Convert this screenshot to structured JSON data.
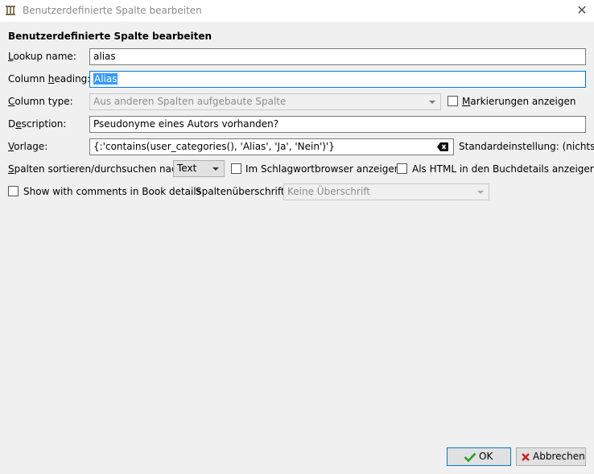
{
  "window": {
    "title": "Benutzerdefinierte Spalte bearbeiten",
    "close_icon": "close-icon",
    "app_icon": "calibre-library-icon"
  },
  "form": {
    "heading": "Benutzerdefinierte Spalte bearbeiten",
    "lookup_name": {
      "label_pre": "L",
      "label_rest": "ookup name:",
      "value": "alias"
    },
    "column_heading": {
      "label_pre": "Column ",
      "label_u": "h",
      "label_post": "eading:",
      "value": "Alias"
    },
    "column_type": {
      "label_pre": "",
      "label_u": "C",
      "label_post": "olumn type:",
      "value": "Aus anderen Spalten aufgebaute Spalte"
    },
    "show_tags": {
      "label_u": "M",
      "label_post": "arkierungen anzeigen",
      "checked": false
    },
    "description": {
      "label_pre": "D",
      "label_u": "e",
      "label_post": "scription:",
      "value": "Pseudonyme eines Autors vorhanden?"
    },
    "template": {
      "label_u": "V",
      "label_post": "orlage:",
      "value": "{:'contains(user_categories(), 'Alias', 'Ja', 'Nein')'}",
      "default_text": "Standardeinstellung: (nichts)"
    },
    "sort_search": {
      "label_u": "S",
      "label_post": "palten sortieren/durchsuchen nach",
      "value": "Text"
    },
    "tag_browser": {
      "label": "Im Schlagwortbrowser anzeigen",
      "checked": false
    },
    "as_html": {
      "label": "Als HTML in den Buchdetails anzeigen",
      "checked": false
    },
    "show_comments": {
      "label": "Show with comments in Book details",
      "checked": false
    },
    "column_header": {
      "label": "Spaltenüberschrift:",
      "value": "Keine Überschrift"
    }
  },
  "buttons": {
    "ok": "OK",
    "cancel": "Abbrechen"
  },
  "colors": {
    "accent": "#0078d7",
    "selection": "#3399ff",
    "ok_check": "#2e9d2e",
    "cancel_x": "#d02020"
  }
}
